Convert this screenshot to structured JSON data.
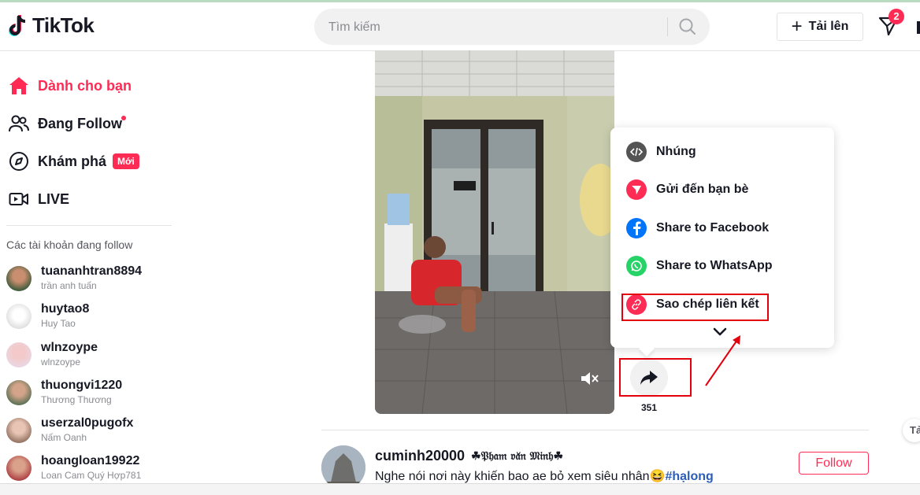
{
  "header": {
    "logo_text": "TikTok",
    "search_placeholder": "Tìm kiếm",
    "upload_label": "Tải lên",
    "inbox_badge": "2"
  },
  "sidebar": {
    "nav": [
      {
        "label": "Dành cho bạn",
        "icon": "home-icon",
        "active": true
      },
      {
        "label": "Đang Follow",
        "icon": "users-icon"
      },
      {
        "label": "Khám phá",
        "icon": "compass-icon",
        "badge": "Mới"
      },
      {
        "label": "LIVE",
        "icon": "live-icon"
      }
    ],
    "following_title": "Các tài khoản đang follow",
    "accounts": [
      {
        "username": "tuananhtran8894",
        "display": "trần anh tuấn"
      },
      {
        "username": "huytao8",
        "display": "Huy Tao"
      },
      {
        "username": "wlnzoype",
        "display": "wlnzoype"
      },
      {
        "username": "thuongvi1220",
        "display": "Thương Thương"
      },
      {
        "username": "userzal0pugofx",
        "display": "Nấm Oanh"
      },
      {
        "username": "hoangloan19922",
        "display": "Loan Cam Quý Hợp781"
      }
    ]
  },
  "video": {
    "share_count": "351"
  },
  "share_menu": {
    "items": [
      {
        "label": "Nhúng",
        "icon": "embed-icon",
        "color": "#545454"
      },
      {
        "label": "Gửi đến bạn bè",
        "icon": "send-icon",
        "color": "#fe2c55"
      },
      {
        "label": "Share to Facebook",
        "icon": "facebook-icon",
        "color": "#0075fa"
      },
      {
        "label": "Share to WhatsApp",
        "icon": "whatsapp-icon",
        "color": "#25d366"
      },
      {
        "label": "Sao chép liên kết",
        "icon": "link-icon",
        "color": "#fe2c55"
      }
    ]
  },
  "next_post": {
    "username": "cuminh20000",
    "nickname": "☘𝔓𝔥𝔞𝔪 𝔳𝔞̆𝔫 𝔐𝔦𝔫𝔥☘",
    "caption": "Nghe nói nơi này khiến bao ae bỏ xem siêu nhân😆",
    "hashtag": "#hạlong",
    "follow_label": "Follow"
  },
  "edge_chip": "Tả",
  "colors": {
    "brand": "#fe2c55",
    "annotation": "#e2000d"
  }
}
